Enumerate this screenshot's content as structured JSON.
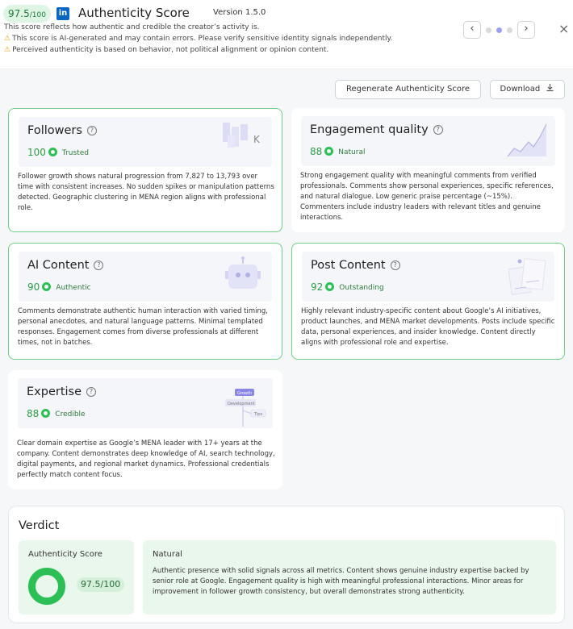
{
  "header": {
    "score_value": "97.5",
    "score_denominator": "/100",
    "logo_text": "in",
    "title": "Authenticity Score",
    "version": "Version 1.5.0",
    "description": "This score reflects how authentic and credible the creator’s activity is.",
    "warnings": [
      "This score is AI-generated and may contain errors. Please verify sensitive identity signals independently.",
      "Perceived authenticity is based on behavior, not political alignment or opinion content."
    ],
    "prev_label": "‹",
    "next_label": "›",
    "close_label": "×",
    "pager_active_index": 1
  },
  "actions": {
    "regenerate_label": "Regenerate Authenticity Score",
    "download_label": "Download"
  },
  "cards": [
    {
      "key": "followers",
      "title": "Followers",
      "score": "100",
      "label": "Trusted",
      "text": "Follower growth shows natural progression from 7,827 to 13,793 over time with consistent increases. No sudden spikes or manipulation patterns detected. Geographic clustering in MENA region aligns with professional role.",
      "icon": "followers-chart-icon",
      "icon_letter": "K"
    },
    {
      "key": "engagement",
      "title": "Engagement quality",
      "score": "88",
      "label": "Natural",
      "text": "Strong engagement quality with meaningful comments from verified professionals. Comments show personal experiences, specific references, and natural dialogue. Low generic praise percentage (~15%). Commenters include industry leaders with relevant titles and genuine interactions.",
      "icon": "trend-chart-icon"
    },
    {
      "key": "ai_content",
      "title": "AI Content",
      "score": "90",
      "label": "Authentic",
      "text": "Comments demonstrate authentic human interaction with varied timing, personal anecdotes, and natural language patterns. Minimal templated responses. Engagement comes from diverse professionals at different times, not in batches.",
      "icon": "robot-icon"
    },
    {
      "key": "post_content",
      "title": "Post Content",
      "score": "92",
      "label": "Outstanding",
      "text": "Highly relevant industry-specific content about Google’s AI initiatives, product launches, and MENA market developments. Posts include specific data, personal experiences, and insider knowledge. Content directly aligns with professional role and expertise.",
      "icon": "documents-icon"
    },
    {
      "key": "expertise",
      "title": "Expertise",
      "score": "88",
      "label": "Credible",
      "text": "Clear domain expertise as Google’s MENA leader with 17+ years at the company. Content demonstrates deep knowledge of AI, search technology, digital payments, and regional market dynamics. Professional credentials perfectly match content focus.",
      "icon": "growth-tree-icon",
      "icon_tags": [
        "Growth",
        "Development",
        "Tips"
      ]
    }
  ],
  "verdict": {
    "title": "Verdict",
    "score_label": "Authenticity Score",
    "score_value": "97.5/100",
    "label": "Natural",
    "text": "Authentic presence with solid signals across all metrics. Content shows genuine industry expertise backed by senior role at Google. Engagement quality is high with meaningful professional interactions. Minor areas for improvement in follower growth consistency, but overall demonstrates strong authenticity."
  },
  "colors": {
    "accent_green": "#2cbf55",
    "card_border_green": "#6fcf86",
    "linkedin_blue": "#0a66c2",
    "warning_amber": "#e0a020",
    "pager_active": "#9e9ef0"
  }
}
